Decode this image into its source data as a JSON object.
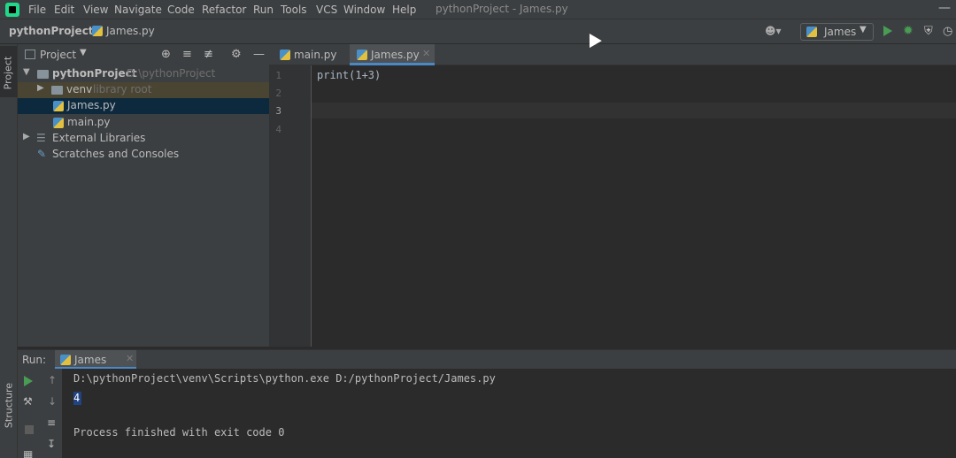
{
  "menu": {
    "items": [
      "File",
      "Edit",
      "View",
      "Navigate",
      "Code",
      "Refactor",
      "Run",
      "Tools",
      "VCS",
      "Window",
      "Help"
    ],
    "window_title": "pythonProject - James.py"
  },
  "navbar": {
    "project": "pythonProject",
    "file": "James.py",
    "run_config": "James"
  },
  "sidebar": {
    "project_tab": "Project",
    "structure_tab": "Structure"
  },
  "project_panel": {
    "header": "Project",
    "tree": {
      "root_label": "pythonProject",
      "root_path": "D:\\pythonProject",
      "venv_label": "venv",
      "venv_hint": "library root",
      "file_james": "James.py",
      "file_main": "main.py",
      "external_libraries": "External Libraries",
      "scratches": "Scratches and Consoles"
    }
  },
  "editor": {
    "tabs": [
      "main.py",
      "James.py"
    ],
    "active_tab": "James.py",
    "line_numbers": [
      "1",
      "2",
      "3",
      "4"
    ],
    "code": [
      "print(1+3)"
    ]
  },
  "run_panel": {
    "label": "Run:",
    "tab": "James",
    "console": [
      "D:\\pythonProject\\venv\\Scripts\\python.exe D:/pythonProject/James.py",
      "4",
      "Process finished with exit code 0"
    ]
  },
  "colors": {
    "background": "#2b2b2b",
    "panel": "#3c3f41",
    "selection": "#0d293e",
    "accent": "#4a88c7",
    "run_green": "#499c54"
  }
}
